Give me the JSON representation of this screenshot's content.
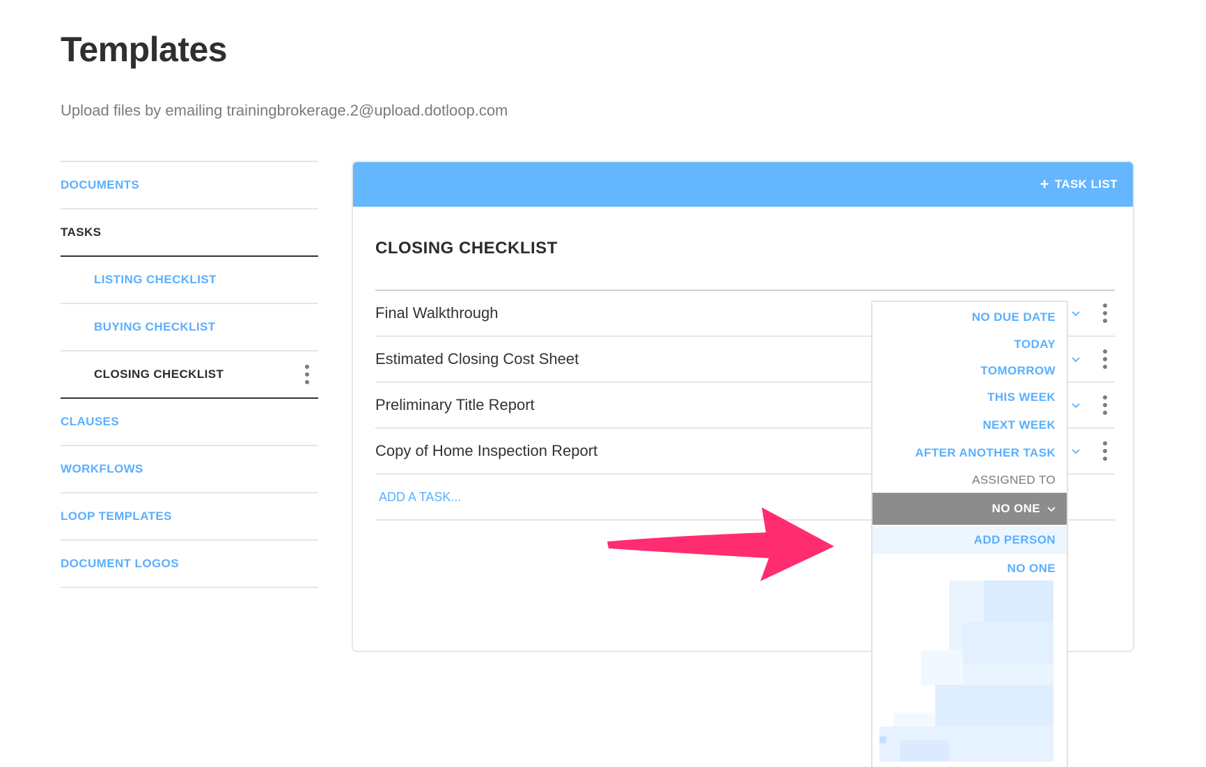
{
  "page": {
    "title": "Templates",
    "subtitle": "Upload files by emailing trainingbrokerage.2@upload.dotloop.com"
  },
  "sidebar": {
    "items": [
      {
        "label": "DOCUMENTS"
      },
      {
        "label": "TASKS"
      },
      {
        "label": "LISTING CHECKLIST"
      },
      {
        "label": "BUYING CHECKLIST"
      },
      {
        "label": "CLOSING CHECKLIST"
      },
      {
        "label": "CLAUSES"
      },
      {
        "label": "WORKFLOWS"
      },
      {
        "label": "LOOP TEMPLATES"
      },
      {
        "label": "DOCUMENT LOGOS"
      }
    ]
  },
  "card": {
    "add_task_list_label": "TASK LIST",
    "checklist_title": "CLOSING CHECKLIST",
    "tasks": [
      {
        "name": "Final Walkthrough"
      },
      {
        "name": "Estimated Closing Cost Sheet"
      },
      {
        "name": "Preliminary Title Report"
      },
      {
        "name": "Copy of Home Inspection Report"
      }
    ],
    "add_task_label": "ADD A TASK..."
  },
  "dropdown": {
    "due_options": [
      "NO DUE DATE",
      "TODAY",
      "TOMORROW",
      "THIS WEEK",
      "NEXT WEEK",
      "AFTER ANOTHER TASK"
    ],
    "assigned_to_label": "ASSIGNED TO",
    "assignee_selected": "NO ONE",
    "add_person_label": "ADD PERSON",
    "no_one_option": "NO ONE"
  },
  "colors": {
    "accent": "#5aafff",
    "header": "#64b6ff",
    "selected": "#8c8c8c",
    "annotation_arrow": "#ff2d6f"
  },
  "icons": {
    "plus": "plus-icon",
    "menu": "kebab-menu-icon",
    "expand": "chevron-down-icon",
    "annotation": "arrow-annotation"
  }
}
